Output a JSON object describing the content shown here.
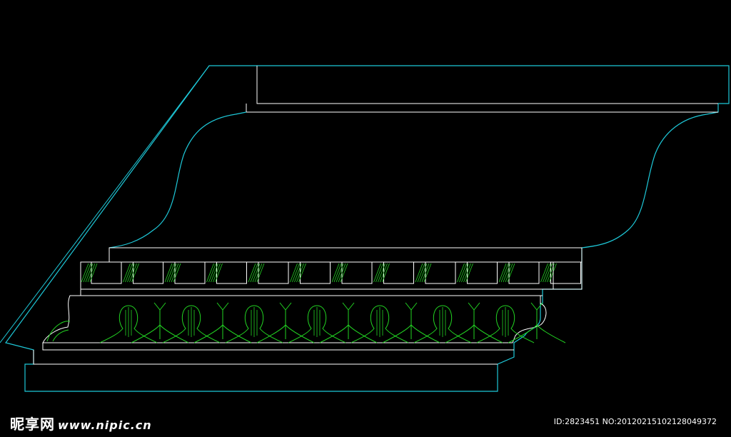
{
  "watermark": {
    "site_name": "昵享网",
    "url": "www.nipic.cn"
  },
  "image_id": "ID:2823451 NO:20120215102128049372",
  "colors": {
    "background": "#000000",
    "outline": "#1ec8d8",
    "detail": "#ffffff",
    "ornament": "#22d422"
  }
}
